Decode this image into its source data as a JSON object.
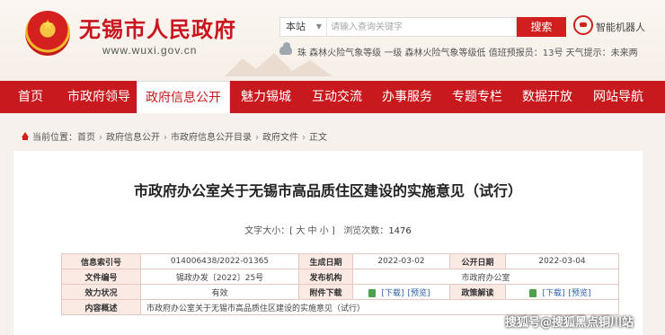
{
  "header": {
    "site_title": "无锡市人民政府",
    "site_url": "www.wuxi.gov.cn",
    "search": {
      "scope": "本站",
      "placeholder": "请输入查询关键字",
      "button": "搜索"
    },
    "robot_label": "智能机器人",
    "weather": "珠 森林火险气象等级 一级   森林火险气象等级低   值班预报员：13号   天气提示：未来两"
  },
  "nav": {
    "items": [
      "首页",
      "市政府领导",
      "政府信息公开",
      "魅力锡城",
      "互动交流",
      "办事服务",
      "专题专栏",
      "数据开放",
      "网站导航"
    ],
    "active_index": 2
  },
  "breadcrumb": {
    "prefix": "当前位置：",
    "items": [
      "首页",
      "政府信息公开",
      "市政府信息公开目录",
      "政府文件",
      "正文"
    ],
    "separator": "›"
  },
  "article": {
    "title": "市政府办公室关于无锡市高品质住区建设的实施意见（试行）",
    "font_size_label": "文字大小：[ 大 中 小 ]",
    "views_label": "浏览次数：",
    "views": "1476"
  },
  "info_table": {
    "row1": {
      "l1": "信息索引号",
      "v1": "014006438/2022-01365",
      "l2": "生成日期",
      "v2": "2022-03-02",
      "l3": "公开日期",
      "v3": "2022-03-04"
    },
    "row2": {
      "l1": "文件编号",
      "v1": "锡政办发〔2022〕25号",
      "l2": "发布机构",
      "v2": "市政府办公室"
    },
    "row3": {
      "l1": "效力状况",
      "v1": "有效",
      "l2": "附件下载",
      "dl1": "[下载]",
      "pv1": "[预览]",
      "l3": "政策解读",
      "dl2": "[下载]",
      "pv2": "[预览]"
    },
    "row4": {
      "l1": "内容概述",
      "v1": "市政府办公室关于无锡市高品质住区建设的实施意见（试行）"
    }
  },
  "watermark": "搜狐号@搜狐黑点铜川站"
}
